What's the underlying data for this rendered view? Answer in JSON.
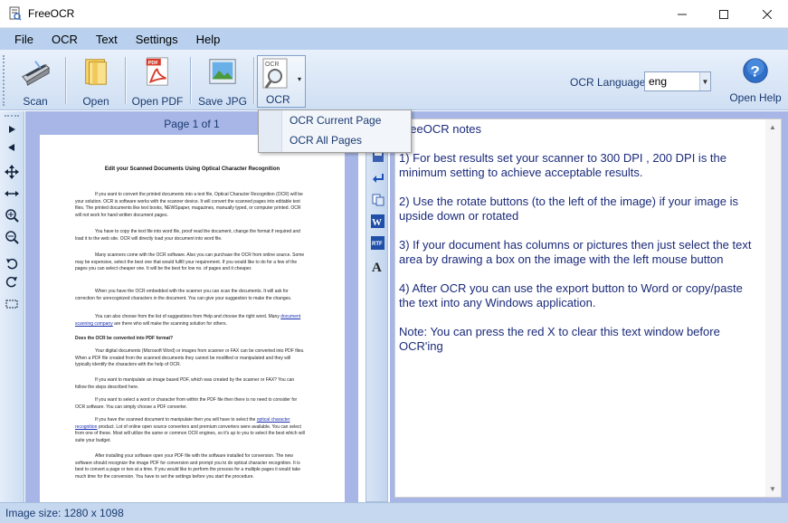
{
  "window": {
    "title": "FreeOCR"
  },
  "menu": {
    "items": [
      "File",
      "OCR",
      "Text",
      "Settings",
      "Help"
    ]
  },
  "toolbar": {
    "scan_label": "Scan",
    "open_label": "Open",
    "open_pdf_label": "Open PDF",
    "save_jpg_label": "Save JPG",
    "ocr_label": "OCR",
    "ocr_language_label": "OCR Language:",
    "ocr_language_value": "eng",
    "open_help_label": "Open Help"
  },
  "ocr_dropdown": {
    "items": [
      "OCR Current Page",
      "OCR All Pages"
    ]
  },
  "image_panel": {
    "page_info": "Page 1 of 1",
    "document": {
      "title": "Edit your Scanned Documents Using Optical Character Recognition",
      "paragraphs": [
        "If you want to convert the printed documents into a text file, Optical Character Recognition (OCR) will be your solution. OCR is software works with the scanner device. It will convert the scanned pages into editable text files. The printed documents like text books, NEWSpaper, magazines, manually typed, or computer printed. OCR will not work for hand written document pages.",
        "You have to copy the text file into word file, proof read the document, change the format if required and load it to the web site. OCR will directly load your document into word file.",
        "Many scanners come with the OCR software. Also you can purchase the OCR from online source. Some may be expensive, select the best one that would fulfill your requirement. If you would like to do for a few of the pages you can select cheaper one. It will be the best for low no. of pages and it cheaper.",
        "When you have the OCR embedded with the scanner you can scan the documents. It will ask for correction for unrecognized characters in the document. You can give your suggestion to make the changes.",
        "You can also choose from the list of suggestions from Help and choose the right word. Many",
        "document scanning company",
        " are there who will make the scanning solution for others.",
        "Does the OCR be converted into PDF format?",
        "Your digital documents (Microsoft Word) or images from scanner or FAX can be converted into PDF files. When a PDF file created from the scanned documents they cannot be modified or manipulated and they will typically identify the characters with the help of OCR.",
        "If you want to manipulate an image based PDF, which was created by the scanner or FAX? You can follow the steps described here.",
        "If you want to select a word or character from within the PDF file then there is no need to consider for OCR software. You can simply choose a PDF converter.",
        "If you have the scanned document to manipulate then you will have to select the ",
        "optical character recognition",
        " product. Lot of online open source converters and premium converters were available.  You can select from one of these. Most will utilize the same or common OCR engines, so it's up to you to select the best which will suite your budget.",
        "After installing your software open your PDF file with the software installed for conversion. The new software should recognize the image PDF for conversion and prompt you to do optical character recognition. It is best to convert a page or two at a time. If you would like to perform the process for a multiple pages it would take much time for the conversion. You have to set the settings before you start the procedure."
      ]
    }
  },
  "text_panel": {
    "lines": [
      "FreeOCR notes",
      "1) For best results set your scanner to 300 DPI , 200 DPI is the minimum setting to achieve acceptable results.",
      "2) Use the rotate buttons (to the left of the image) if your image is upside down or rotated",
      "3) If your document has columns or pictures then just select the text area by drawing a box on the image with the left mouse button",
      "4) After OCR you can use the export button to Word or copy/paste the text into any Windows application.",
      "Note: You can press the red X to clear this text window before OCR'ing"
    ]
  },
  "status": {
    "image_size": "Image size:  1280 x  1098"
  },
  "colors": {
    "menu_bg": "#b9d1ee",
    "panel_bg": "#a7b6e6",
    "text_color": "#1a2a7a",
    "link_color": "#1a2fb0"
  }
}
